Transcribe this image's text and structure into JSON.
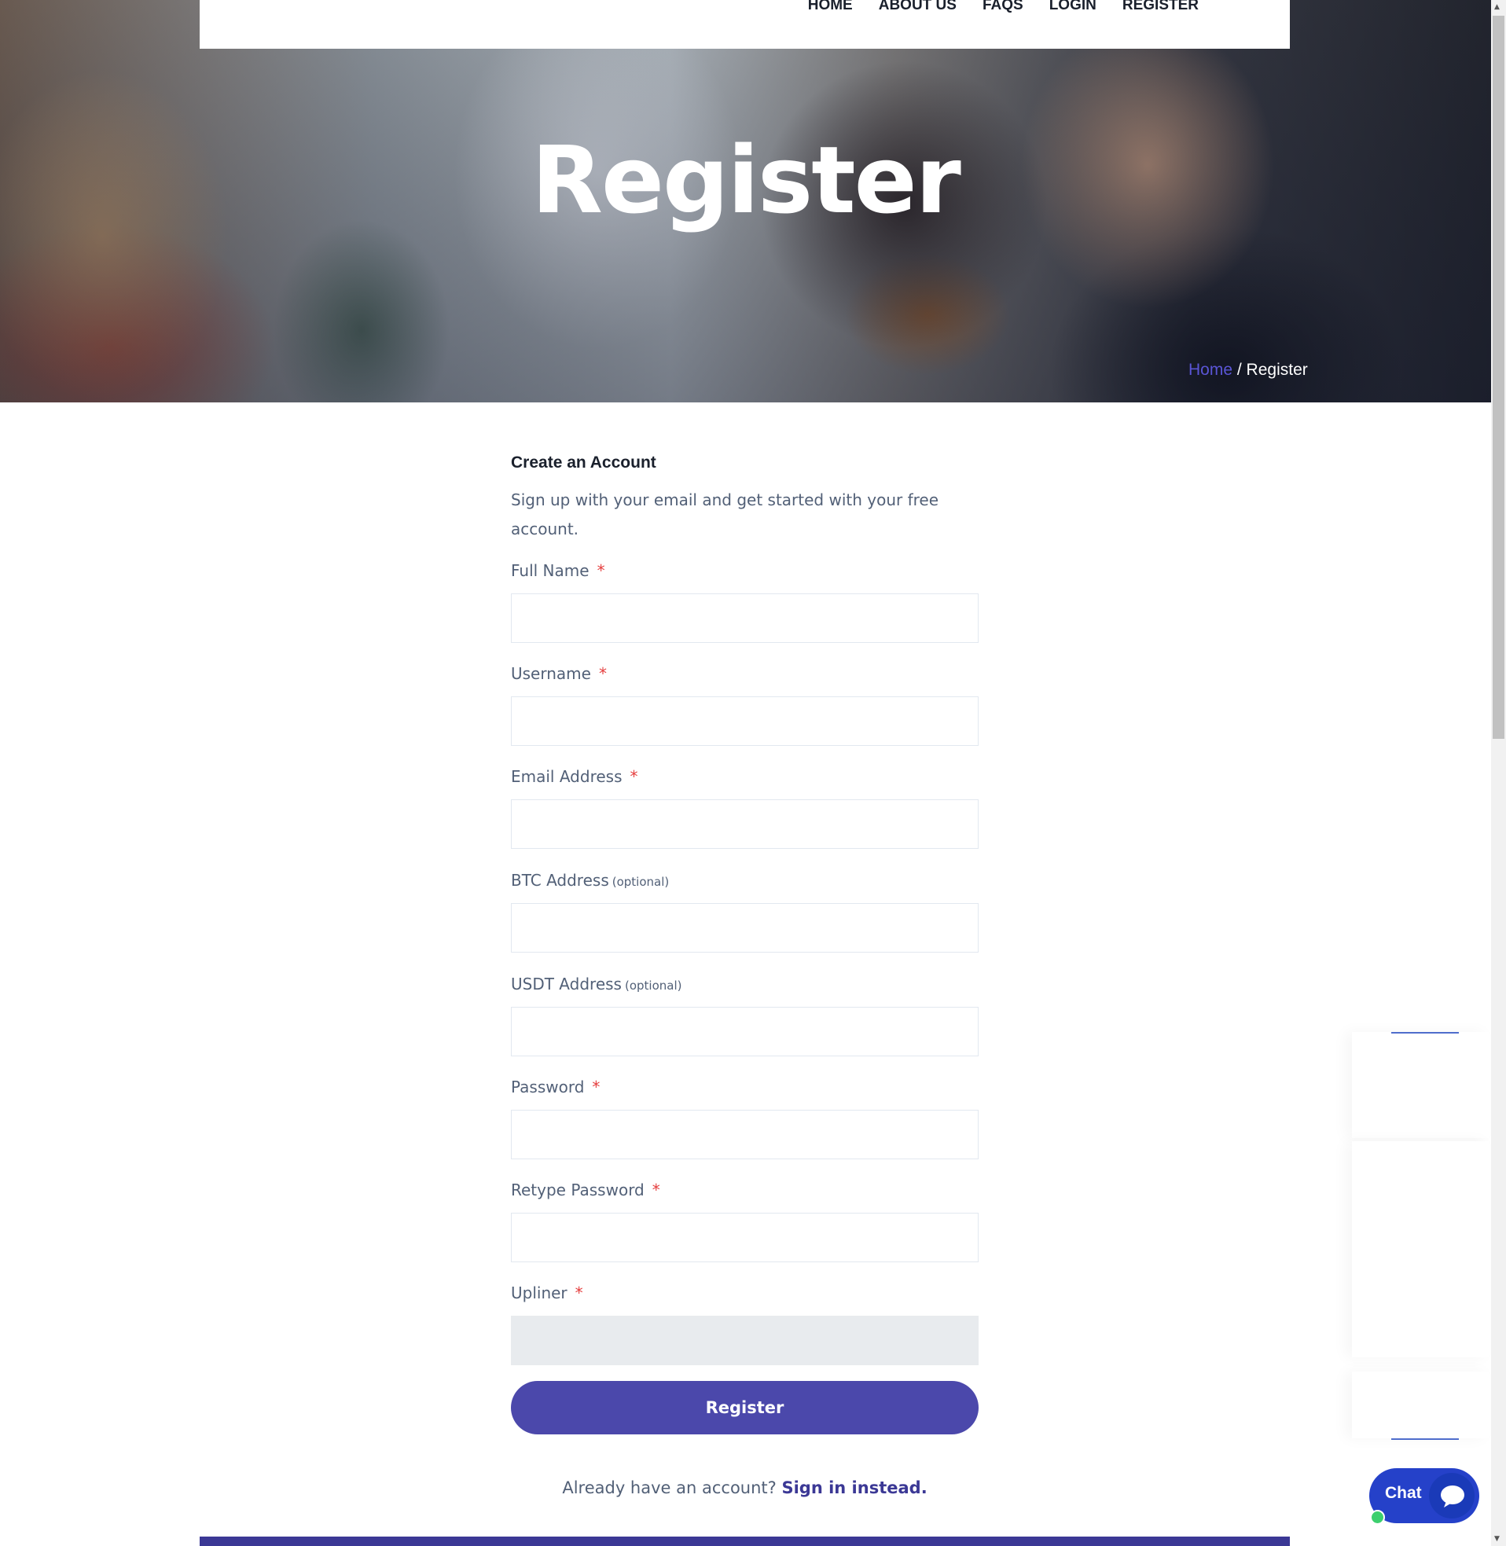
{
  "nav": {
    "items": [
      {
        "label": "HOME"
      },
      {
        "label": "ABOUT US"
      },
      {
        "label": "FAQS"
      },
      {
        "label": "LOGIN"
      },
      {
        "label": "REGISTER"
      }
    ]
  },
  "hero": {
    "title": "Register",
    "breadcrumb": {
      "home": "Home",
      "separator": " / ",
      "current": "Register"
    }
  },
  "form": {
    "title": "Create an Account",
    "subtitle": "Sign up with your email and get started with your free account.",
    "required_mark": "*",
    "optional_mark": "(optional)",
    "fields": {
      "full_name": {
        "label": "Full Name",
        "value": ""
      },
      "username": {
        "label": "Username",
        "value": ""
      },
      "email": {
        "label": "Email Address",
        "value": ""
      },
      "btc": {
        "label": "BTC Address",
        "value": ""
      },
      "usdt": {
        "label": "USDT Address",
        "value": ""
      },
      "password": {
        "label": "Password",
        "value": ""
      },
      "retype_password": {
        "label": "Retype Password",
        "value": ""
      },
      "upliner": {
        "label": "Upliner",
        "value": ""
      }
    },
    "submit_label": "Register",
    "signin_prompt": "Already have an account?",
    "signin_link": "Sign in instead."
  },
  "chat": {
    "label": "Chat"
  },
  "colors": {
    "accent": "#4b48ab",
    "link": "#3b3895",
    "required": "#e53e3e",
    "chat": "#2541c9",
    "online": "#3ccf6e"
  }
}
